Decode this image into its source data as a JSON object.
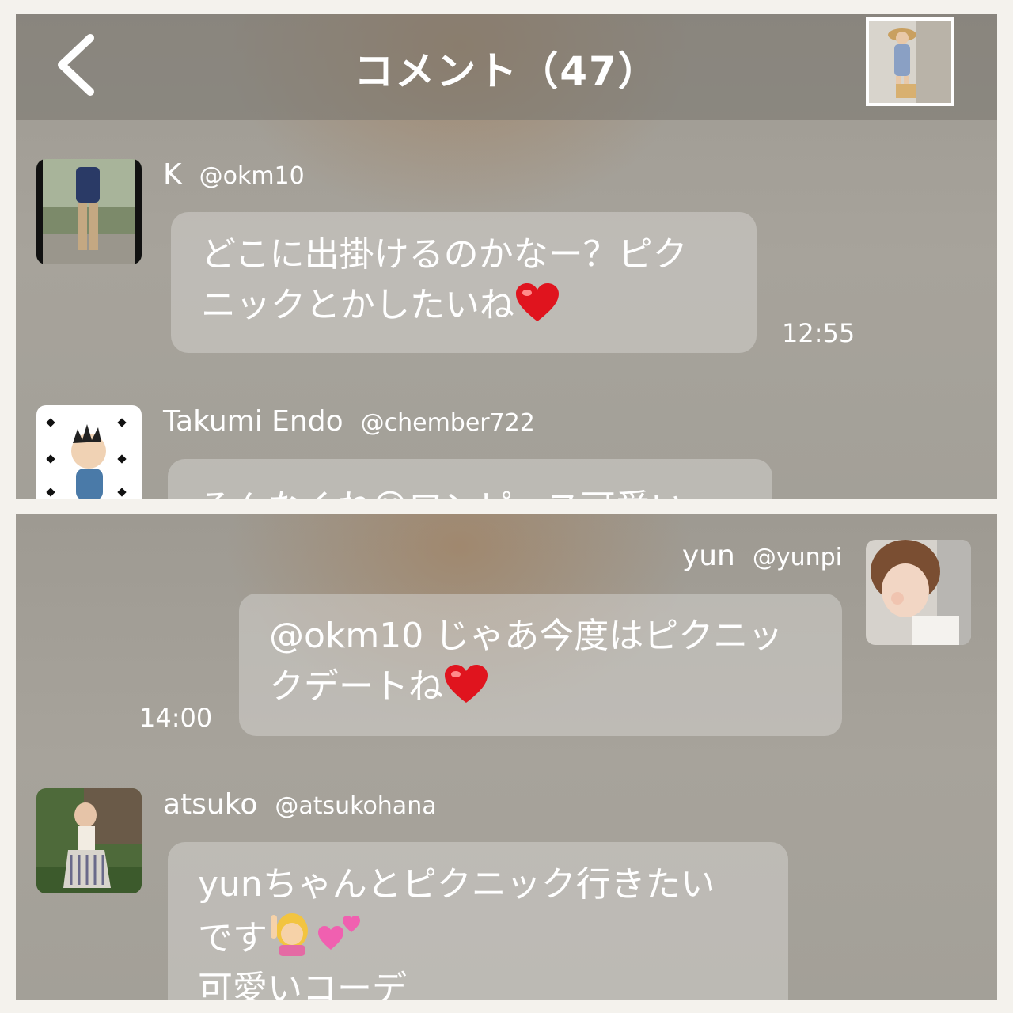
{
  "header": {
    "title": "コメント（47）",
    "back_icon": "chevron-left-icon"
  },
  "comments_top": [
    {
      "name": "K",
      "handle": "@okm10",
      "line1": "どこに出掛けるのかなー？ピク",
      "line2": "ニックとかしたいね",
      "time": "12:55"
    },
    {
      "name": "Takumi Endo",
      "handle": "@chember722",
      "partial_text": "そんなくね😊ワンピース可愛い"
    }
  ],
  "comments_bottom": [
    {
      "name": "yun",
      "handle": "@yunpi",
      "line1": "@okm10 じゃあ今度はピクニッ",
      "line2": "クデートね",
      "time": "14:00"
    },
    {
      "name": "atsuko",
      "handle": "@atsukohana",
      "line1": "yunちゃんとピクニック行きたい",
      "line2": "です",
      "line3": "可愛いコーデ"
    }
  ],
  "colors": {
    "heart": "#e0141e",
    "bubble": "#d2d0cc",
    "text": "#ffffff"
  }
}
